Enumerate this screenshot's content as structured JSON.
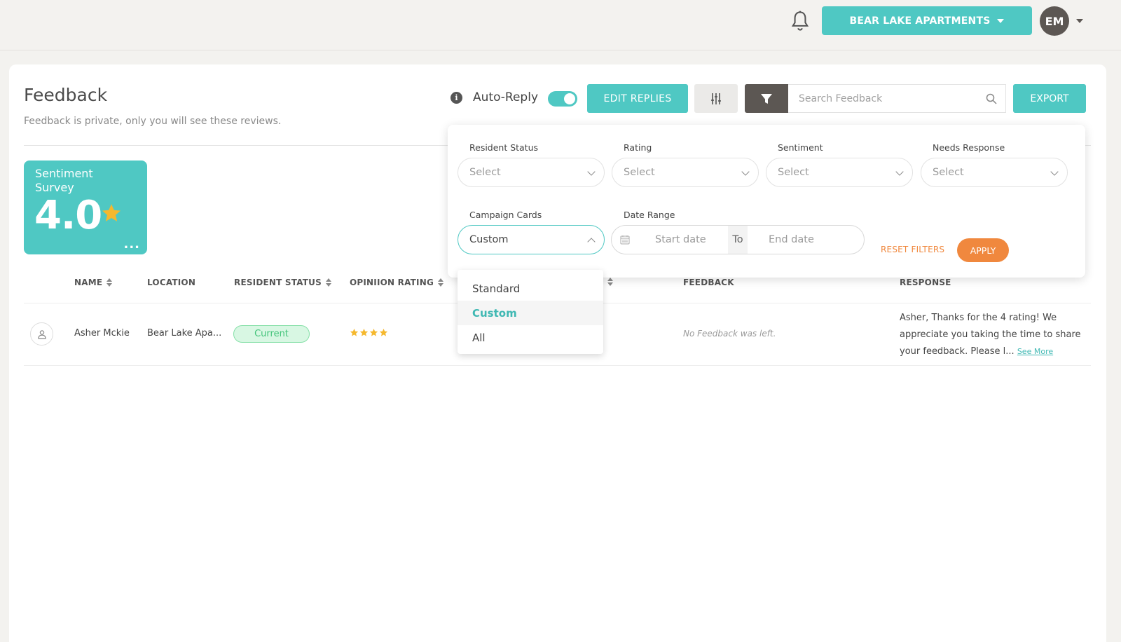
{
  "header": {
    "property_label": "BEAR LAKE APARTMENTS",
    "avatar_initials": "EM"
  },
  "page": {
    "title": "Feedback",
    "subtitle": "Feedback is private, only you will see these reviews."
  },
  "toolbar": {
    "auto_reply_label": "Auto-Reply",
    "auto_reply_on": true,
    "edit_replies_label": "EDIT REPLIES",
    "search_placeholder": "Search Feedback",
    "export_label": "EXPORT"
  },
  "sentiment_card": {
    "title": "Sentiment Survey",
    "score": "4.0",
    "more": "..."
  },
  "table": {
    "columns": [
      "NAME",
      "LOCATION",
      "RESIDENT STATUS",
      "OPINIION RATING",
      "FEEDBACK",
      "RESPONSE"
    ],
    "rows": [
      {
        "name": "Asher Mckie",
        "location": "Bear Lake Apa...",
        "status": "Current",
        "rating": 4,
        "feedback": "No Feedback was left.",
        "response": "Asher, Thanks for the 4 rating! We appreciate you taking the time to share your feedback. Please l...",
        "see_more": "See More"
      }
    ]
  },
  "filters": {
    "resident_status": {
      "label": "Resident Status",
      "value": "Select"
    },
    "rating": {
      "label": "Rating",
      "value": "Select"
    },
    "sentiment": {
      "label": "Sentiment",
      "value": "Select"
    },
    "needs_response": {
      "label": "Needs Response",
      "value": "Select"
    },
    "campaign_cards": {
      "label": "Campaign Cards",
      "value": "Custom",
      "options": [
        "Standard",
        "Custom",
        "All"
      ]
    },
    "date_range": {
      "label": "Date Range",
      "start_placeholder": "Start date",
      "to": "To",
      "end_placeholder": "End date"
    },
    "reset_label": "RESET FILTERS",
    "apply_label": "APPLY"
  },
  "colors": {
    "accent": "#4fc8c3",
    "orange": "#f0883e",
    "dark": "#5c5753",
    "star": "#f5b82e"
  }
}
